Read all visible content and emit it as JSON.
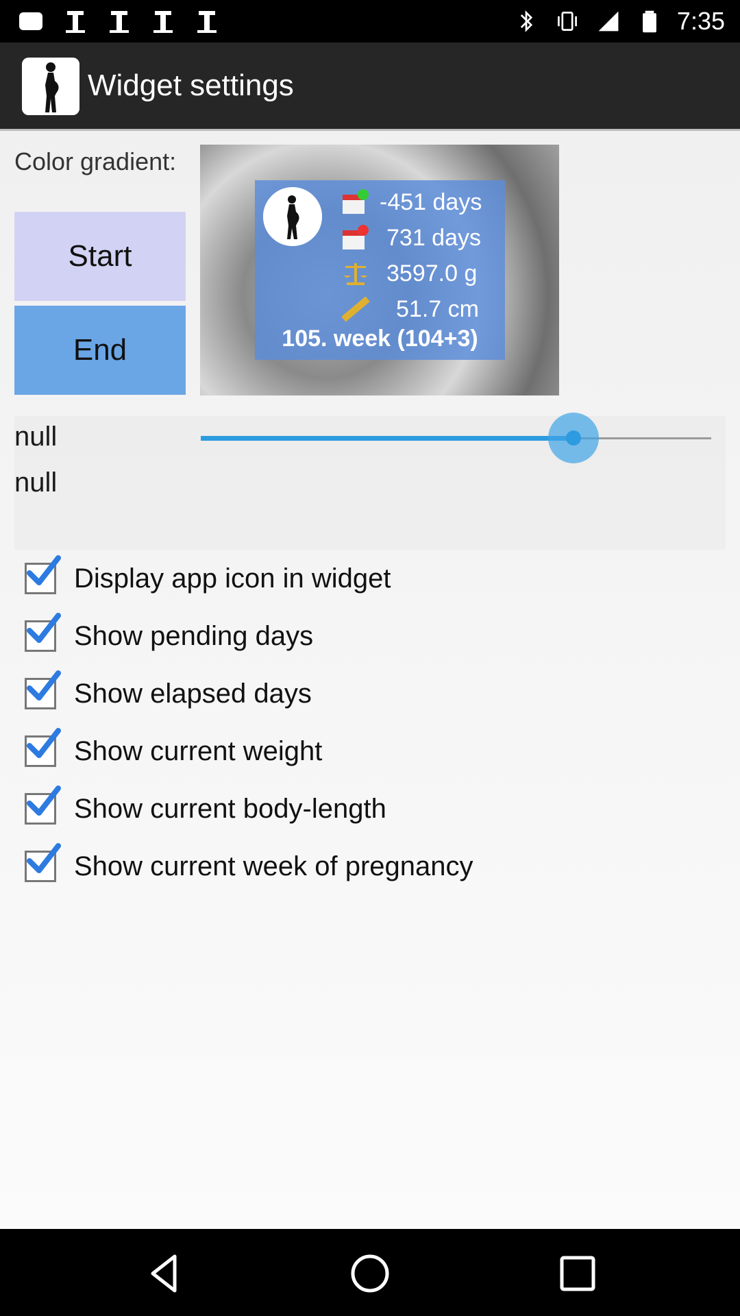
{
  "status_bar": {
    "time": "7:35",
    "icons": [
      "notification-icon",
      "notification-icon",
      "notification-icon",
      "notification-icon",
      "notification-icon",
      "bluetooth-icon",
      "vibrate-icon",
      "signal-icon",
      "battery-icon"
    ]
  },
  "app_bar": {
    "title": "Widget settings",
    "logo_icon": "pregnant-silhouette-icon"
  },
  "color_gradient": {
    "label": "Color gradient:",
    "start_label": "Start",
    "end_label": "End",
    "start_color": "#d2d2f4",
    "end_color": "#6aa6e6"
  },
  "widget_preview": {
    "pending_days": "-451 days",
    "elapsed_days": "731 days",
    "weight": "3597.0 g",
    "length": "51.7 cm",
    "week": "105. week (104+3)"
  },
  "slider": {
    "label_1": "null",
    "label_2": "null",
    "value_fraction": 0.73,
    "accent_color": "#2d9be0"
  },
  "options": [
    {
      "label": "Display app icon in widget",
      "checked": true
    },
    {
      "label": "Show pending days",
      "checked": true
    },
    {
      "label": "Show elapsed days",
      "checked": true
    },
    {
      "label": "Show current weight",
      "checked": true
    },
    {
      "label": "Show current body-length",
      "checked": true
    },
    {
      "label": "Show current week of pregnancy",
      "checked": true
    }
  ],
  "nav_bar": {
    "icons": [
      "back-icon",
      "home-icon",
      "recents-icon"
    ]
  }
}
